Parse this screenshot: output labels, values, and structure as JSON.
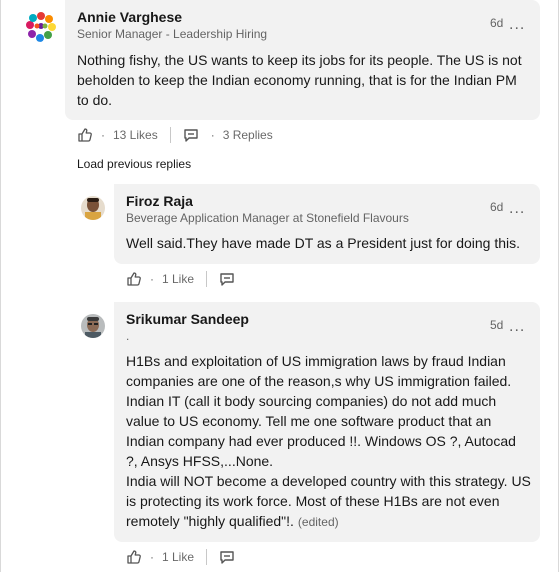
{
  "comment": {
    "author": "Annie Varghese",
    "headline": "Senior Manager - Leadership Hiring",
    "time": "6d",
    "more": "...",
    "body": "Nothing fishy, the US wants to keep its jobs for its people. The US is not beholden to  keep the Indian economy running, that is for the Indian PM to do.",
    "likes": "13 Likes",
    "replies": "3 Replies",
    "dot": "·"
  },
  "load_previous_label": "Load previous replies",
  "replies": [
    {
      "author": "Firoz Raja",
      "headline": "Beverage Application Manager at Stonefield Flavours",
      "time": "6d",
      "more": "...",
      "body": "Well said.They have made DT as a President just for doing this.",
      "likes": "1 Like",
      "dot": "·"
    },
    {
      "author": "Srikumar Sandeep",
      "headline": ".",
      "time": "5d",
      "more": "...",
      "body_lines": [
        "H1Bs and exploitation of US immigration laws by fraud Indian companies are one of the reason,s why US immigration failed. Indian IT (call it body sourcing companies) do not add much value to US economy. Tell me one software product that an Indian company had ever produced !!. Windows OS ?, Autocad ?, Ansys HFSS,...None.",
        "India will NOT become a developed country with this strategy. US is protecting its work force. Most of these H1Bs are not even remotely \"highly qualified\"!."
      ],
      "edited": "(edited)",
      "likes": "1 Like",
      "dot": "·"
    }
  ],
  "colors": {
    "bubble": "#f2f2f2",
    "muted_text": "#666666",
    "text": "#191919"
  },
  "icons": [
    "like-icon",
    "reply-icon",
    "more-icon"
  ]
}
